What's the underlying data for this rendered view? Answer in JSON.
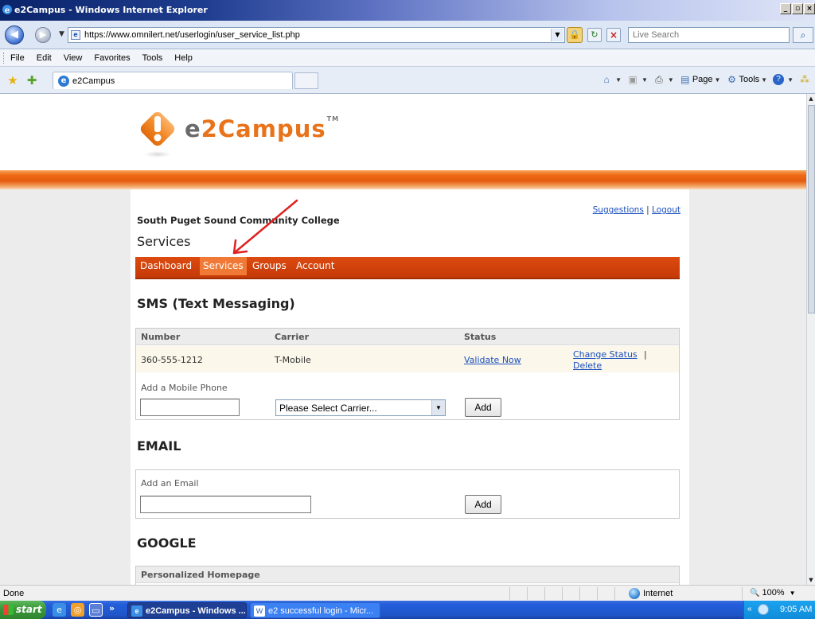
{
  "window": {
    "title": "e2Campus - Windows Internet Explorer",
    "buttons": [
      "_",
      "×"
    ]
  },
  "address_bar": {
    "url": "https://www.omnilert.net/userlogin/user_service_list.php",
    "search_placeholder": "Live Search"
  },
  "menu": [
    "File",
    "Edit",
    "View",
    "Favorites",
    "Tools",
    "Help"
  ],
  "favorites_bar": {
    "tab_title": "e2Campus",
    "commands": [
      {
        "label": "",
        "icon": "home-icon"
      },
      {
        "label": "",
        "icon": "feeds-icon"
      },
      {
        "label": "",
        "icon": "print-icon"
      },
      {
        "label": "Page",
        "icon": "page-icon"
      },
      {
        "label": "Tools",
        "icon": "tools-gear-icon"
      },
      {
        "label": "",
        "icon": "help-icon"
      }
    ]
  },
  "site": {
    "logo_part1": "e",
    "logo_part2": "2",
    "logo_part3": "Campus",
    "logo_tm": "TM",
    "college": "South Puget Sound Community College",
    "links": {
      "suggestions": "Suggestions",
      "separator": "|",
      "logout": "Logout"
    },
    "page_heading": "Services",
    "nav": [
      {
        "label": "Dashboard",
        "active": false
      },
      {
        "label": "Services",
        "active": true
      },
      {
        "label": "Groups",
        "active": false
      },
      {
        "label": "Account",
        "active": false
      }
    ]
  },
  "sms": {
    "title": "SMS (Text Messaging)",
    "headers": [
      "Number",
      "Carrier",
      "Status"
    ],
    "row": {
      "number": "360-555-1212",
      "carrier": "T-Mobile",
      "status_link": "Validate Now",
      "change_status": "Change Status",
      "separator": "|",
      "delete": "Delete"
    },
    "add_label": "Add a Mobile Phone",
    "carrier_select": "Please Select Carrier...",
    "add_button": "Add"
  },
  "email": {
    "title": "EMAIL",
    "add_label": "Add an Email",
    "add_button": "Add"
  },
  "google": {
    "title": "GOOGLE",
    "header": "Personalized Homepage"
  },
  "status_bar": {
    "status": "Done",
    "zone": "Internet",
    "zoom": "100%"
  },
  "taskbar": {
    "start": "start",
    "tasks": [
      {
        "label": "e2Campus - Windows ...",
        "active": true
      },
      {
        "label": "e2 successful login - Micr...",
        "active": false
      }
    ],
    "clock": "9:05 AM"
  },
  "colors": {
    "brand_orange": "#e8731a",
    "nav_red": "#c53a08",
    "nav_active": "#f07a35",
    "link_blue": "#1a4fbf",
    "annotation_red": "#e02020"
  }
}
